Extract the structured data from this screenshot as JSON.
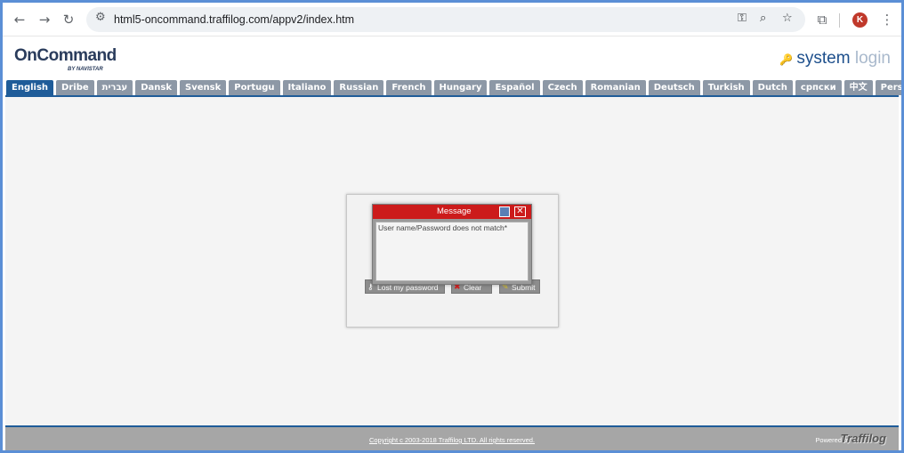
{
  "browser": {
    "url": "html5-oncommand.traffilog.com/appv2/index.htm",
    "avatar_letter": "K",
    "icons": [
      "back-icon",
      "forward-icon",
      "reload-icon",
      "site-info-icon",
      "password-key-icon",
      "zoom-icon",
      "bookmark-star-icon",
      "extensions-icon",
      "menu-icon"
    ]
  },
  "header": {
    "logo": "OnCommand",
    "logo_sub": "BY NAVISTAR",
    "login_title_a": "system",
    "login_title_b": "login"
  },
  "tabs": [
    {
      "label": "English",
      "active": true
    },
    {
      "label": "Dribe"
    },
    {
      "label": "עברית"
    },
    {
      "label": "Dansk"
    },
    {
      "label": "Svensk"
    },
    {
      "label": "Portugu"
    },
    {
      "label": "Italiano"
    },
    {
      "label": "Russian"
    },
    {
      "label": "French"
    },
    {
      "label": "Hungary"
    },
    {
      "label": "Español"
    },
    {
      "label": "Czech"
    },
    {
      "label": "Romanian"
    },
    {
      "label": "Deutsch"
    },
    {
      "label": "Turkish"
    },
    {
      "label": "Dutch"
    },
    {
      "label": "српски"
    },
    {
      "label": "中文"
    },
    {
      "label": "Personal"
    }
  ],
  "login": {
    "lost_password": "Lost my password",
    "clear": "Clear",
    "submit": "Submit"
  },
  "message": {
    "title": "Message",
    "text": "User name/Password does not match*"
  },
  "footer": {
    "copyright": "Copyright c 2003-2018 Traffilog LTD. All rights reserved.",
    "powered_by": "Powered by",
    "brand": "Traffilog"
  },
  "colors": {
    "accent": "#1f5c99",
    "dialog_title": "#cc1b1b",
    "tab": "#8d98a6"
  }
}
